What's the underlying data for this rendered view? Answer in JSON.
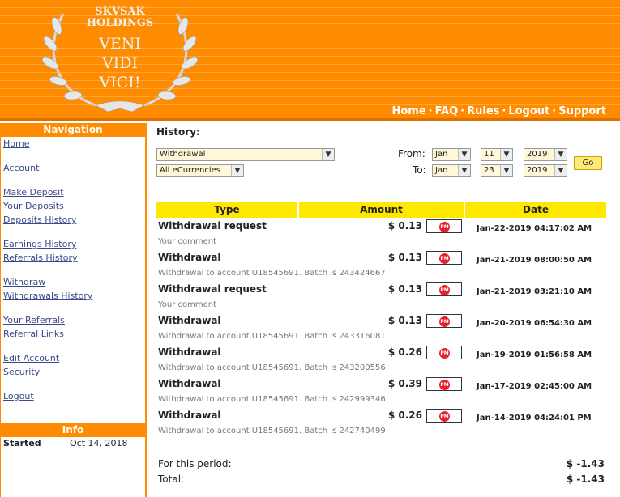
{
  "logo": {
    "line1": "SKVSAK",
    "line2": "HOLDINGS",
    "motto1": "VENI",
    "motto2": "VIDI",
    "motto3": "VICI!"
  },
  "topnav": [
    "Home",
    "FAQ",
    "Rules",
    "Logout",
    "Support"
  ],
  "sidebar": {
    "nav_title": "Navigation",
    "links": [
      "Home",
      "Account",
      "Make Deposit",
      "Your Deposits",
      "Deposits History",
      "Earnings History",
      "Referrals History",
      "Withdraw",
      "Withdrawals History",
      "Your Referrals",
      "Referral Links",
      "Edit Account",
      "Security",
      "Logout"
    ],
    "info_title": "Info",
    "info_label": "Started",
    "info_value": "Oct 14, 2018"
  },
  "history": {
    "title": "History:",
    "type_select": "Withdrawal",
    "currency_select": "All eCurrencies",
    "from_label": "From:",
    "to_label": "To:",
    "from": {
      "month": "Jan",
      "day": "11",
      "year": "2019"
    },
    "to": {
      "month": "Jan",
      "day": "23",
      "year": "2019"
    },
    "go_label": "Go"
  },
  "table": {
    "headers": [
      "Type",
      "Amount",
      "Date"
    ],
    "pm_label": "PM",
    "rows": [
      {
        "type": "Withdrawal request",
        "amount": "$ 0.13",
        "date": "Jan-22-2019 04:17:02 AM",
        "desc": "Your comment"
      },
      {
        "type": "Withdrawal",
        "amount": "$ 0.13",
        "date": "Jan-21-2019 08:00:50 AM",
        "desc": "Withdrawal to account U18545691. Batch is 243424667"
      },
      {
        "type": "Withdrawal request",
        "amount": "$ 0.13",
        "date": "Jan-21-2019 03:21:10 AM",
        "desc": "Your comment"
      },
      {
        "type": "Withdrawal",
        "amount": "$ 0.13",
        "date": "Jan-20-2019 06:54:30 AM",
        "desc": "Withdrawal to account U18545691. Batch is 243316081"
      },
      {
        "type": "Withdrawal",
        "amount": "$ 0.26",
        "date": "Jan-19-2019 01:56:58 AM",
        "desc": "Withdrawal to account U18545691. Batch is 243200556"
      },
      {
        "type": "Withdrawal",
        "amount": "$ 0.39",
        "date": "Jan-17-2019 02:45:00 AM",
        "desc": "Withdrawal to account U18545691. Batch is 242999346"
      },
      {
        "type": "Withdrawal",
        "amount": "$ 0.26",
        "date": "Jan-14-2019 04:24:01 PM",
        "desc": "Withdrawal to account U18545691. Batch is 242740499"
      }
    ]
  },
  "totals": {
    "period_label": "For this period:",
    "period_value": "$ -1.43",
    "total_label": "Total:",
    "total_value": "$ -1.43"
  },
  "colors": {
    "accent": "#ff8c00",
    "header_yellow": "#ffe800",
    "link": "#3a4a8a"
  }
}
